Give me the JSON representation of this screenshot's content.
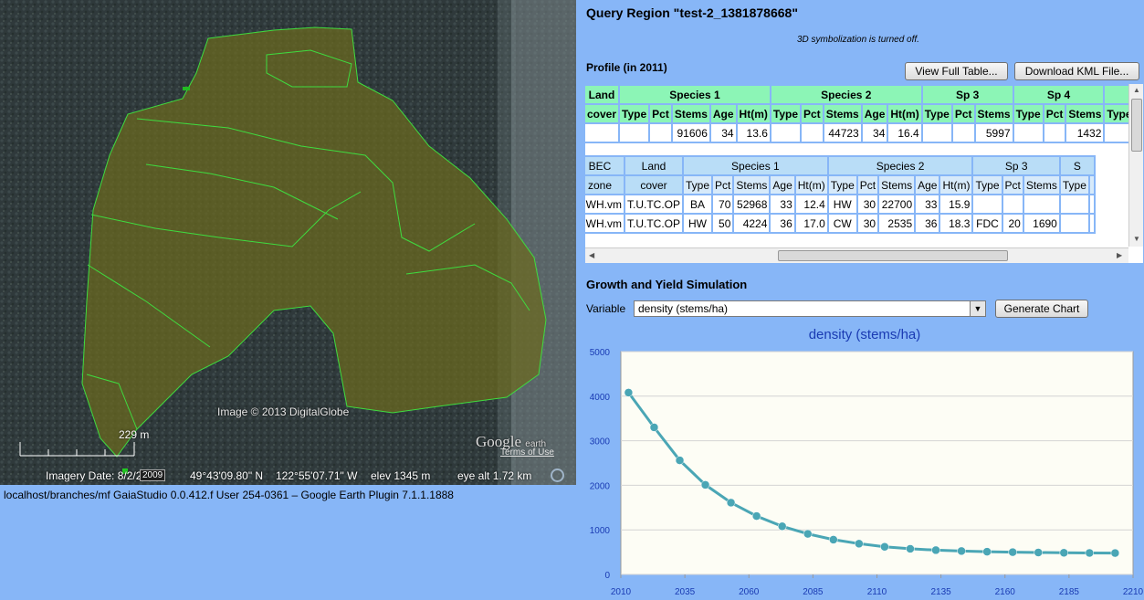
{
  "map": {
    "credit": "Image © 2013 DigitalGlobe",
    "logo": "Google",
    "logo_sub": "earth",
    "terms": "Terms of Use",
    "scale": "229 m",
    "imagery_date": "Imagery Date: 8/2/2009",
    "date_box": "2009",
    "lat": "49°43'09.80\" N",
    "lon": "122°55'07.71\" W",
    "elev": "elev  1345 m",
    "eye_alt": "eye alt   1.72 km"
  },
  "footer": "localhost/branches/mf   GaiaStudio 0.0.412.f   User 254-0361   –   Google Earth Plugin 7.1.1.1888",
  "query": {
    "title": "Query Region \"test-2_1381878668\"",
    "symbolization_note": "3D symbolization is turned off.",
    "profile_title": "Profile (in 2011)",
    "btn_full_table": "View Full Table...",
    "btn_kml": "Download KML File..."
  },
  "table1": {
    "land_cover": [
      "Land",
      "cover"
    ],
    "groups": [
      "Species 1",
      "Species 2",
      "Sp 3",
      "Sp 4"
    ],
    "cols": [
      "Type",
      "Pct",
      "Stems",
      "Age",
      "Ht(m)"
    ],
    "row": [
      "",
      "",
      "",
      "91606",
      "34",
      "13.6",
      "",
      "",
      "44723",
      "34",
      "16.4",
      "",
      "",
      "5997",
      "",
      "",
      "1432"
    ]
  },
  "table2": {
    "bec": [
      "BEC",
      "zone"
    ],
    "land_cover": [
      "Land",
      "cover"
    ],
    "groups": [
      "Species 1",
      "Species 2",
      "Sp 3",
      "S"
    ],
    "cols": [
      "Type",
      "Pct",
      "Stems",
      "Age",
      "Ht(m)"
    ],
    "rows": [
      [
        "CWH.vm",
        "T.U.TC.OP",
        "BA",
        "70",
        "52968",
        "33",
        "12.4",
        "HW",
        "30",
        "22700",
        "33",
        "15.9",
        "",
        "",
        ""
      ],
      [
        "CWH.vm",
        "T.U.TC.OP",
        "HW",
        "50",
        "4224",
        "36",
        "17.0",
        "CW",
        "30",
        "2535",
        "36",
        "18.3",
        "FDC",
        "20",
        "1690"
      ]
    ]
  },
  "growth": {
    "title": "Growth and Yield Simulation",
    "variable_label": "Variable",
    "variable_value": "density (stems/ha)",
    "generate_btn": "Generate Chart"
  },
  "chart_data": {
    "type": "line",
    "title": "density (stems/ha)",
    "xlabel": "",
    "ylabel": "",
    "ylim": [
      0,
      5000
    ],
    "xlim": [
      2010,
      2210
    ],
    "yticks": [
      0,
      1000,
      2000,
      3000,
      4000,
      5000
    ],
    "xticks": [
      2010,
      2035,
      2060,
      2085,
      2110,
      2135,
      2160,
      2185,
      2210
    ],
    "x": [
      2013,
      2023,
      2033,
      2043,
      2053,
      2063,
      2073,
      2083,
      2093,
      2103,
      2113,
      2123,
      2133,
      2143,
      2153,
      2163,
      2173,
      2183,
      2193,
      2203
    ],
    "values": [
      4080,
      3300,
      2560,
      2010,
      1610,
      1310,
      1080,
      910,
      780,
      690,
      620,
      575,
      545,
      525,
      510,
      500,
      492,
      486,
      482,
      480
    ],
    "color": "#4aa6b5"
  }
}
